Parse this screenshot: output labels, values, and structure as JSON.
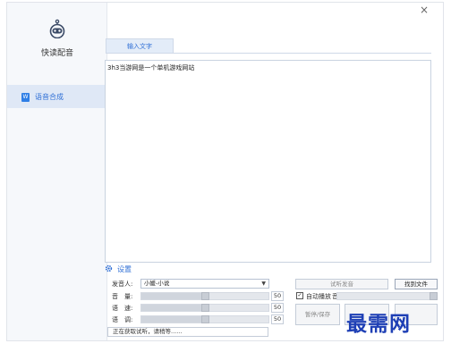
{
  "app": {
    "title": "快读配音",
    "close_glyph": "×"
  },
  "sidebar": {
    "items": [
      {
        "label": "语音合成",
        "icon": "word-doc-icon"
      }
    ]
  },
  "tabs": [
    {
      "label": "输入文字",
      "active": true
    }
  ],
  "editor": {
    "text": "3h3当游网是一个单机游戏网站"
  },
  "settings": {
    "title": "设置",
    "speaker": {
      "label": "发音人:",
      "value": "小媛-小说"
    },
    "volume": {
      "label": "音　量:",
      "value": "50",
      "level": 0.5
    },
    "speed": {
      "label": "语　速:",
      "value": "50",
      "level": 0.5
    },
    "pitch": {
      "label": "语　调:",
      "value": "50",
      "level": 0.5
    }
  },
  "buttons": {
    "preview": "试听发音",
    "find_file": "找到文件",
    "pause_save": "暂停/保存",
    "auto_play": "自动播放",
    "auto_play_checked": true,
    "volume_label": "音量",
    "volume_level": 0.97
  },
  "status": {
    "text": "正在获取试听，请稍等......"
  },
  "watermark": {
    "text": "最需网"
  },
  "colors": {
    "accent": "#2f6fd6",
    "sidebar_bg": "#f6f8fb",
    "nav_active_bg": "#dfe8f6",
    "watermark": "#1e3fb5"
  }
}
